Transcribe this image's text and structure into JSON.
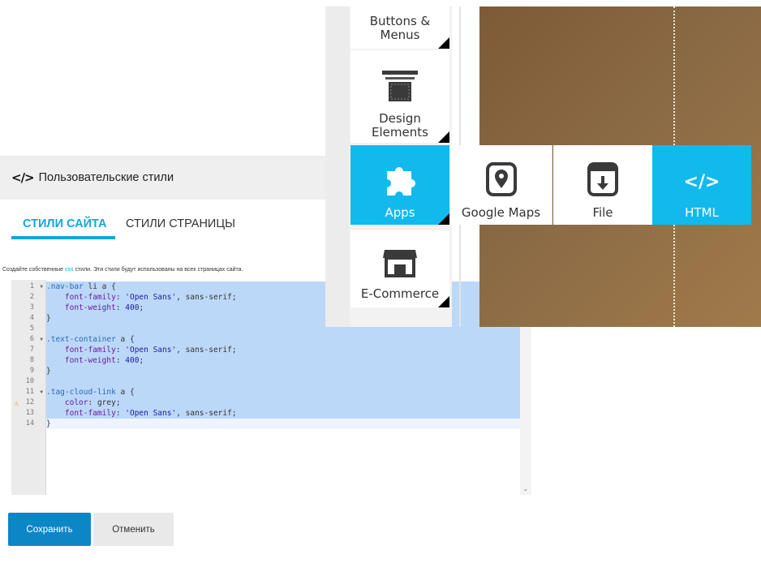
{
  "panel": {
    "code_icon": "</>",
    "title": "Пользовательские стили",
    "tabs": [
      {
        "label": "Стили сайта",
        "active": true
      },
      {
        "label": "Стили страницы",
        "active": false
      }
    ],
    "hint": {
      "before": "Создайте собственные ",
      "link": "css",
      "after": " стили. Эти стили будут использованы на всех страницах сайта."
    },
    "editor": {
      "lines": [
        {
          "num": "1",
          "text": ".nav-bar li a {",
          "fold": true
        },
        {
          "num": "2",
          "text": "    font-family: 'Open Sans', sans-serif;"
        },
        {
          "num": "3",
          "text": "    font-weight: 400;"
        },
        {
          "num": "4",
          "text": "}"
        },
        {
          "num": "5",
          "text": ""
        },
        {
          "num": "6",
          "text": ".text-container a {",
          "fold": true
        },
        {
          "num": "7",
          "text": "    font-family: 'Open Sans', sans-serif;"
        },
        {
          "num": "8",
          "text": "    font-weight: 400;"
        },
        {
          "num": "9",
          "text": "}"
        },
        {
          "num": "10",
          "text": ""
        },
        {
          "num": "11",
          "text": ".tag-cloud-link a {",
          "fold": true
        },
        {
          "num": "12",
          "text": "    color: grey;",
          "warning": true
        },
        {
          "num": "13",
          "text": "    font-family: 'Open Sans', sans-serif;"
        },
        {
          "num": "14",
          "text": "}"
        }
      ]
    },
    "buttons": {
      "save": "Сохранить",
      "cancel": "Отменить"
    }
  },
  "builder": {
    "sidebar": [
      {
        "label": "Buttons & Menus",
        "icon": "buttons-icon"
      },
      {
        "label": "Design Elements",
        "icon": "design-elements-icon"
      },
      {
        "label": "Apps",
        "icon": "puzzle-icon",
        "active": true
      },
      {
        "label": "E-Commerce",
        "icon": "store-icon"
      }
    ],
    "flyout": [
      {
        "label": "Apps",
        "icon": "puzzle-icon"
      },
      {
        "label": "Google Maps",
        "icon": "map-pin-icon"
      },
      {
        "label": "File",
        "icon": "file-download-icon"
      },
      {
        "label": "HTML",
        "icon": "code-icon"
      }
    ]
  },
  "colors": {
    "accent": "#10a7dd",
    "save_button": "#0d86c6",
    "app_tile": "#12b9ec",
    "selection": "#bcd8f9"
  }
}
